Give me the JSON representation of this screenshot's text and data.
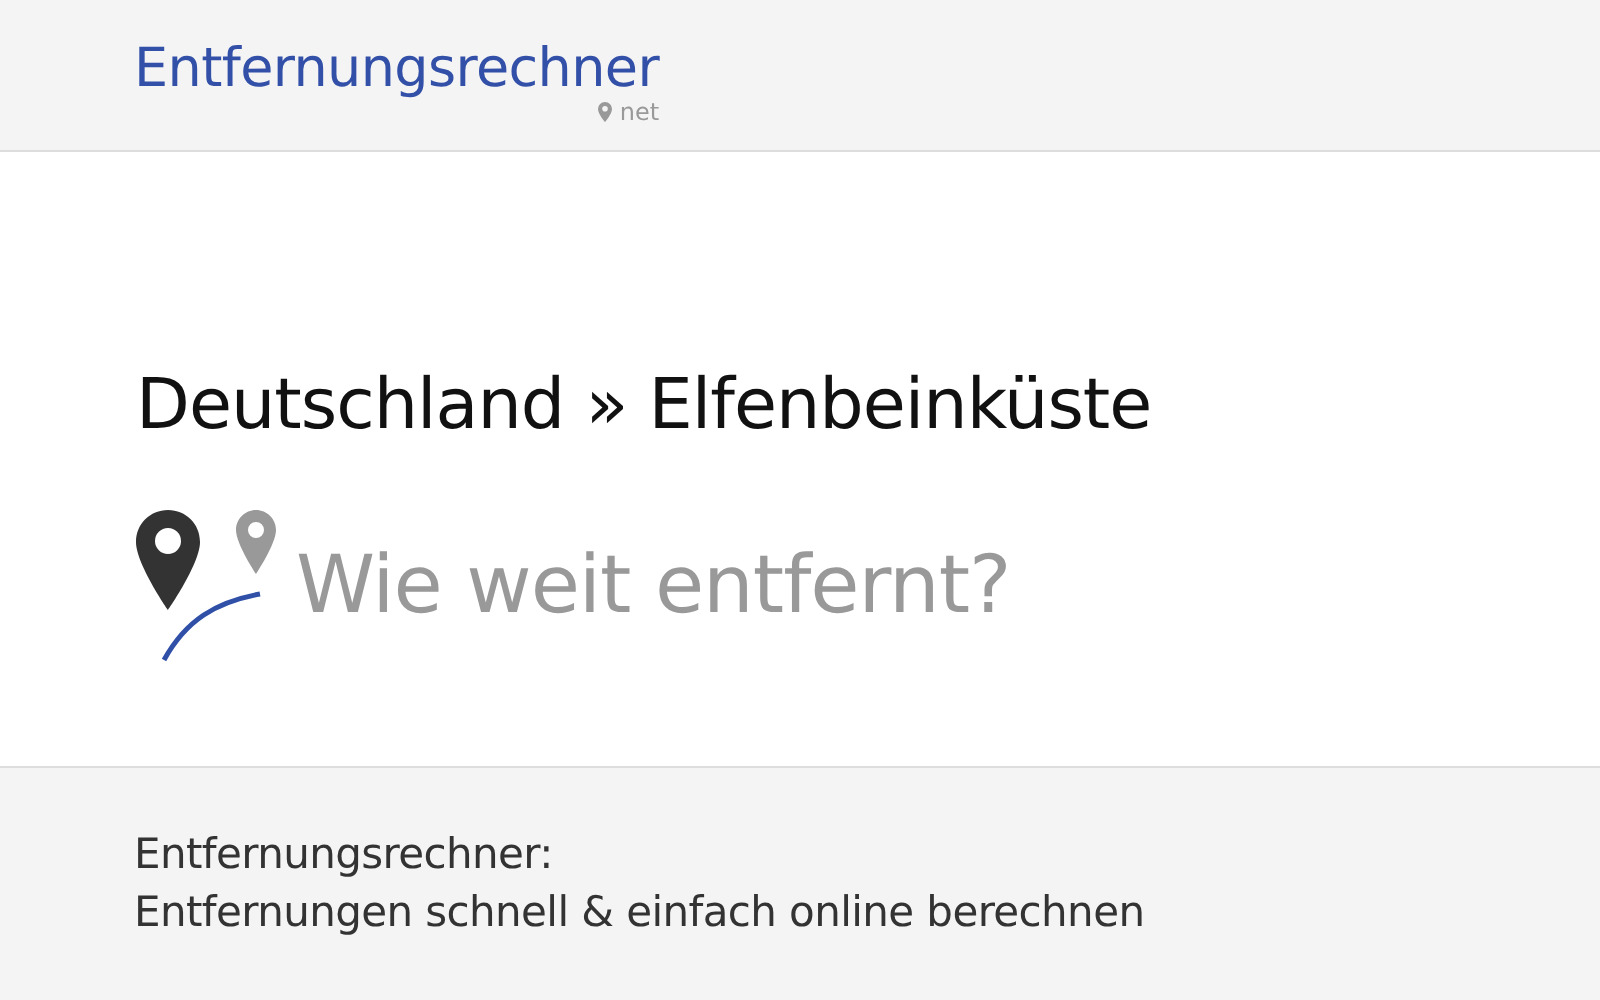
{
  "header": {
    "logo": "Entfernungsrechner",
    "logo_suffix": "net"
  },
  "heading": "Deutschland » Elfenbeinküste",
  "subtitle": "Wie weit entfernt?",
  "footer": {
    "lines": [
      "Entfernungsrechner:",
      "Entfernungen schnell & einfach online berechnen"
    ]
  }
}
